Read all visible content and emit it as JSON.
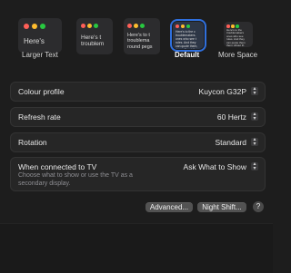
{
  "resolution_options": [
    {
      "label": "Larger Text",
      "preview": "Here's",
      "selected": false
    },
    {
      "label": "",
      "preview": "Here's t\ntroublem",
      "selected": false
    },
    {
      "label": "",
      "preview": "Here's to t\ntroublema\nround pegs",
      "selected": false
    },
    {
      "label": "Default",
      "preview": "Here's to the c\ntroublemakers.\nones who see t\nrules. And they\ncan quote them,\nthem. About the",
      "selected": true
    },
    {
      "label": "More Space",
      "preview": "Here's to the\ntroublemakers\nones who see\nrules. And they\ncan quote them\nthem. About th",
      "selected": false
    }
  ],
  "settings": {
    "colour_profile": {
      "label": "Colour profile",
      "value": "Kuycon G32P"
    },
    "refresh_rate": {
      "label": "Refresh rate",
      "value": "60 Hertz"
    },
    "rotation": {
      "label": "Rotation",
      "value": "Standard"
    },
    "tv": {
      "label": "When connected to TV",
      "value": "Ask What to Show",
      "description": "Choose what to show or use the TV as a secondary display."
    }
  },
  "buttons": {
    "advanced": "Advanced...",
    "night_shift": "Night Shift...",
    "help": "?"
  },
  "colors": {
    "traffic_red": "#ff5f57",
    "traffic_yellow": "#febc2e",
    "traffic_green": "#28c840",
    "accent": "#2f6fdd"
  }
}
